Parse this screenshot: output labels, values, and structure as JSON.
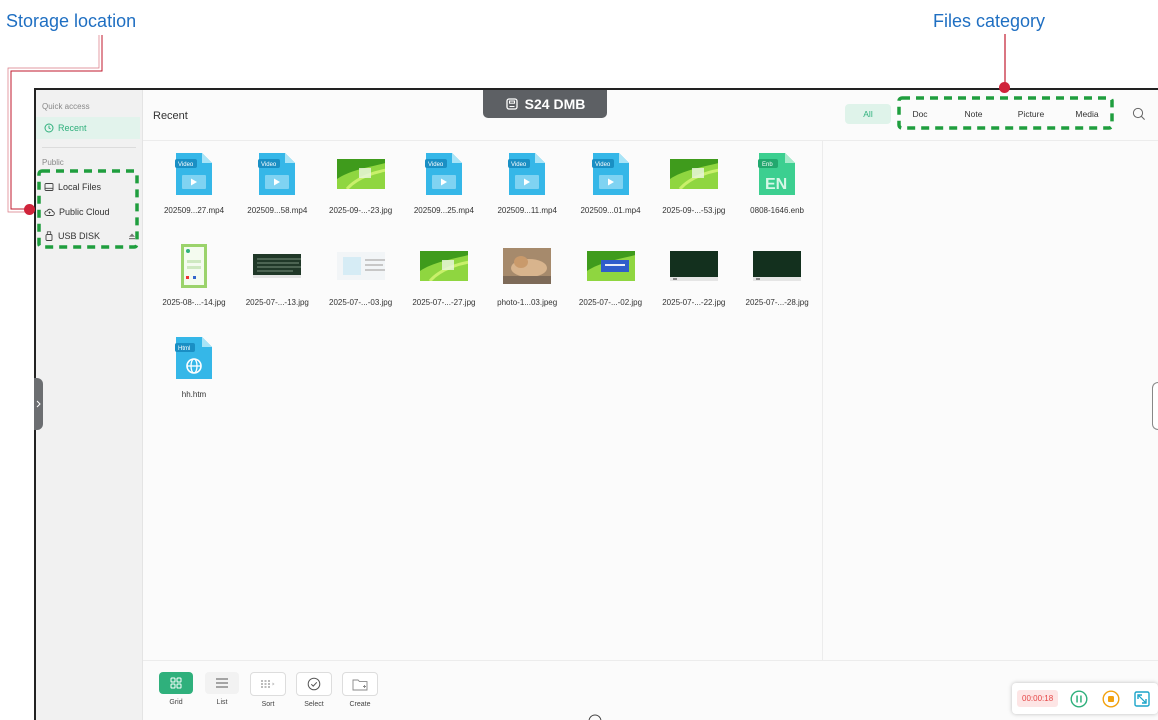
{
  "callouts": {
    "storage": "Storage location",
    "category": "Files category"
  },
  "colors": {
    "accent": "#2fb07c",
    "callout_text": "#1f6fc2",
    "callout_line": "#d0233a",
    "highlight_box": "#1f9e3e"
  },
  "device_badge": {
    "icon": "storage-device-icon",
    "label": "S24 DMB"
  },
  "sidebar": {
    "quick_access_label": "Quick access",
    "recent": {
      "icon": "clock-icon",
      "label": "Recent"
    },
    "public_label": "Public",
    "items": [
      {
        "icon": "drive-icon",
        "label": "Local Files"
      },
      {
        "icon": "cloud-icon",
        "label": "Public Cloud"
      },
      {
        "icon": "usb-icon",
        "label": "USB DISK",
        "action_icon": "eject-icon"
      }
    ]
  },
  "header": {
    "title": "Recent"
  },
  "tabs": [
    "All",
    "Doc",
    "Note",
    "Picture",
    "Media"
  ],
  "search": {
    "icon": "search-icon"
  },
  "files": [
    {
      "name": "202509...27.mp4",
      "type": "video",
      "tag": "Video"
    },
    {
      "name": "202509...58.mp4",
      "type": "video",
      "tag": "Video"
    },
    {
      "name": "2025-09-...-23.jpg",
      "type": "image"
    },
    {
      "name": "202509...25.mp4",
      "type": "video",
      "tag": "Video"
    },
    {
      "name": "202509...11.mp4",
      "type": "video",
      "tag": "Video"
    },
    {
      "name": "202509...01.mp4",
      "type": "video",
      "tag": "Video"
    },
    {
      "name": "2025-09-...-53.jpg",
      "type": "image"
    },
    {
      "name": "0808-1646.enb",
      "type": "enb",
      "tag": "Enb",
      "glyph": "EN"
    },
    {
      "name": "2025-08-...-14.jpg",
      "type": "image-ui"
    },
    {
      "name": "2025-07-...-13.jpg",
      "type": "image-board"
    },
    {
      "name": "2025-07-...-03.jpg",
      "type": "image-doc"
    },
    {
      "name": "2025-07-...-27.jpg",
      "type": "image"
    },
    {
      "name": "photo-1...03.jpeg",
      "type": "image-photo"
    },
    {
      "name": "2025-07-...-02.jpg",
      "type": "image-dialog"
    },
    {
      "name": "2025-07-...-22.jpg",
      "type": "image-dark"
    },
    {
      "name": "2025-07-...-28.jpg",
      "type": "image-dark"
    },
    {
      "name": "hh.htm",
      "type": "html",
      "tag": "Html"
    }
  ],
  "toolbar": [
    {
      "icon": "grid-icon",
      "label": "Grid",
      "active": true
    },
    {
      "icon": "list-icon",
      "label": "List",
      "active": false
    },
    {
      "icon": "sort-icon",
      "label": "Sort",
      "active": false
    },
    {
      "icon": "select-icon",
      "label": "Select",
      "active": false
    },
    {
      "icon": "new-folder-icon",
      "label": "Create",
      "active": false
    }
  ],
  "recorder": {
    "time": "00:00:18",
    "pause_icon": "pause-icon",
    "stop_icon": "stop-icon",
    "expand_icon": "expand-icon"
  }
}
